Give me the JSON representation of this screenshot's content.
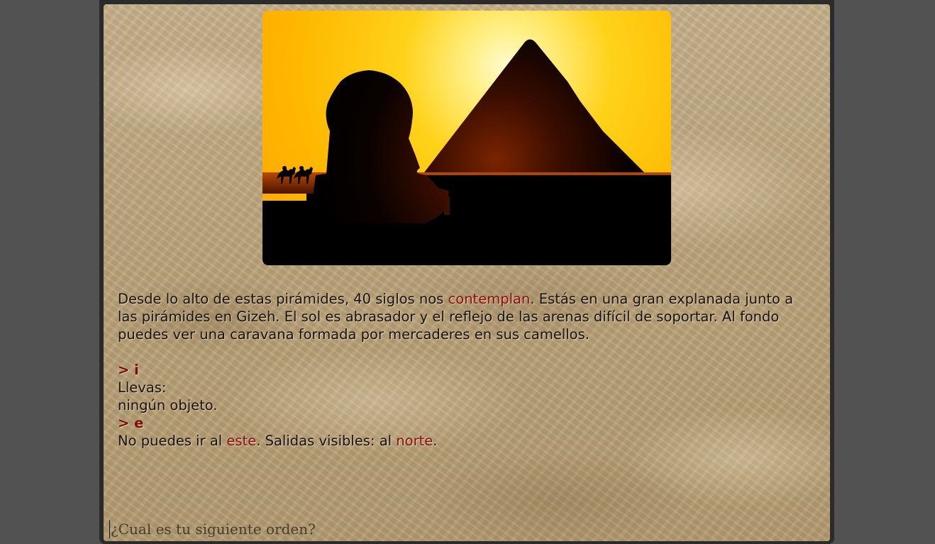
{
  "scene": {
    "image_icon": "pyramids-sphinx-sunset-illustration",
    "sky_top": "#ffb400",
    "sky_glow": "#fff6b0",
    "silhouette": "#000000"
  },
  "description": {
    "pre": "Desde lo alto de estas pirámides, 40 siglos nos ",
    "link1": "contemplan",
    "post": ". Estás en una gran explanada junto a las pirámides en Gizeh. El sol es abrasador y el reflejo de las arenas difícil de soportar. Al fondo puedes ver una caravana formada por mercaderes en sus camellos."
  },
  "transcript": {
    "cmd1": "> i",
    "inv_label": "Llevas:",
    "inv_value": "ningún objeto.",
    "cmd2": "> e",
    "resp_pre": "No puedes ir al ",
    "resp_link1": "este",
    "resp_mid": ". Salidas visibles: al ",
    "resp_link2": "norte",
    "resp_post": "."
  },
  "prompt": {
    "placeholder": "¿Cual es tu siguiente orden?"
  },
  "colors": {
    "highlight": "#8b1010",
    "command": "#7a0c0c",
    "backdrop": "#525252"
  }
}
